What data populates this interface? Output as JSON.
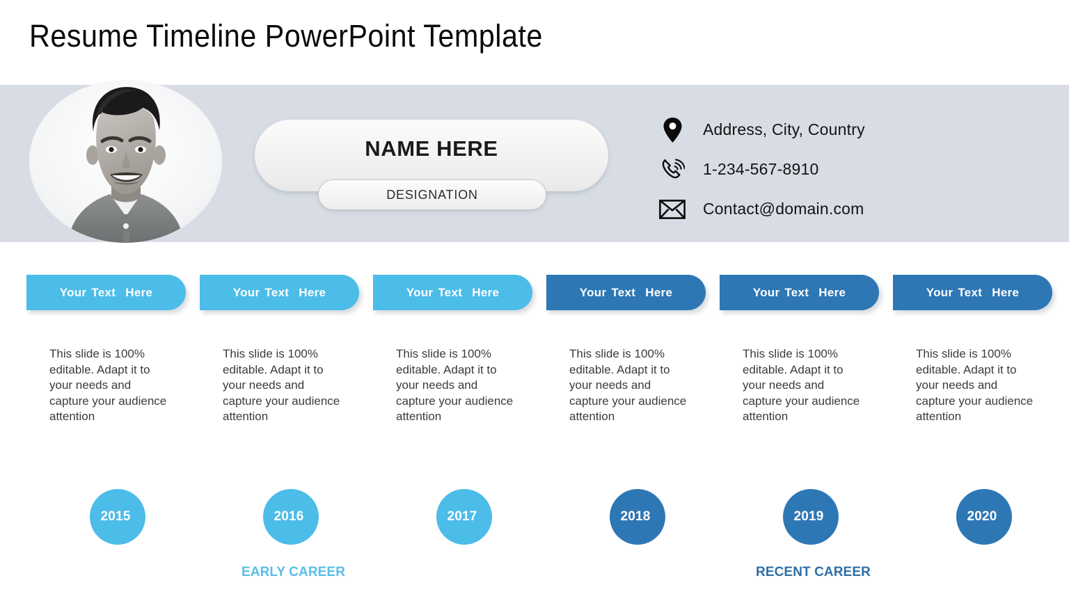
{
  "slide": {
    "title": "Resume Timeline PowerPoint Template"
  },
  "profile": {
    "name": "NAME HERE",
    "designation": "DESIGNATION",
    "avatar_icon": "person-photo",
    "contacts": [
      {
        "icon": "location-pin-icon",
        "text": "Address, City, Country"
      },
      {
        "icon": "phone-icon",
        "text": "1-234-567-8910"
      },
      {
        "icon": "envelope-icon",
        "text": "Contact@domain.com"
      }
    ]
  },
  "colors": {
    "light_blue": "#4cbce9",
    "dark_blue": "#2e77b5",
    "band": "#d8dde5",
    "body_text": "#3b3b3b",
    "early_career": "#58bde8",
    "recent_career": "#2e6ea8"
  },
  "columns": [
    {
      "banner_label": "Your Text Here",
      "body": "This slide is 100% editable. Adapt it to your needs and capture your audience attention",
      "year": "2015",
      "accent": "#4cbce9"
    },
    {
      "banner_label": "Your Text Here",
      "body": "This slide is 100% editable. Adapt it to your needs and capture your audience attention",
      "year": "2016",
      "accent": "#4cbce9"
    },
    {
      "banner_label": "Your Text Here",
      "body": "This slide is 100% editable. Adapt it to your needs and capture your audience attention",
      "year": "2017",
      "accent": "#4cbce9"
    },
    {
      "banner_label": "Your Text Here",
      "body": "This slide is 100% editable. Adapt it to your needs and capture your audience attention",
      "year": "2018",
      "accent": "#2e77b5"
    },
    {
      "banner_label": "Your Text Here",
      "body": "This slide is 100% editable. Adapt it to your needs and capture your audience attention",
      "year": "2019",
      "accent": "#2e77b5"
    },
    {
      "banner_label": "Your Text Here",
      "body": "This slide is 100% editable. Adapt it to your needs and capture your audience attention",
      "year": "2020",
      "accent": "#2e77b5"
    }
  ],
  "captions": {
    "early": "EARLY CAREER",
    "recent": "RECENT CAREER"
  }
}
